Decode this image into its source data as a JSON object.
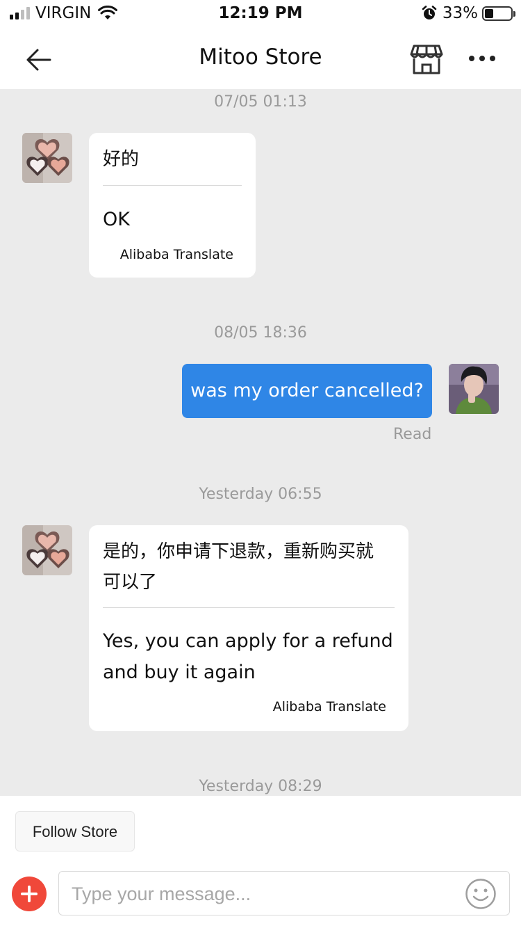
{
  "status_bar": {
    "carrier": "VIRGIN",
    "time": "12:19 PM",
    "battery_text": "33%",
    "battery_level": 0.33
  },
  "nav": {
    "title": "Mitoo Store",
    "back_icon": "back-arrow-icon",
    "store_icon": "store-icon",
    "more_icon": "more-icon"
  },
  "messages": [
    {
      "timestamp": "07/05 01:13",
      "sender": "store",
      "original": "好的",
      "translation": "OK",
      "credit": "Alibaba Translate"
    },
    {
      "timestamp": "08/05 18:36",
      "sender": "me",
      "text": "was my order cancelled?",
      "status": "Read"
    },
    {
      "timestamp": "Yesterday 06:55",
      "sender": "store",
      "original_lines": [
        "是的，你申请下退款，重新购买就",
        "可以了"
      ],
      "translation_lines": [
        "Yes, you can apply for a refund",
        "and buy it again"
      ],
      "credit": "Alibaba Translate"
    },
    {
      "timestamp": "Yesterday 08:29"
    }
  ],
  "bottom": {
    "follow_label": "Follow Store",
    "input_placeholder": "Type your message...",
    "add_icon": "plus-icon",
    "emoji_icon": "emoji-icon"
  },
  "colors": {
    "accent_blue": "#2f86e6",
    "accent_red": "#f0483a",
    "chat_background": "#ebebeb"
  }
}
